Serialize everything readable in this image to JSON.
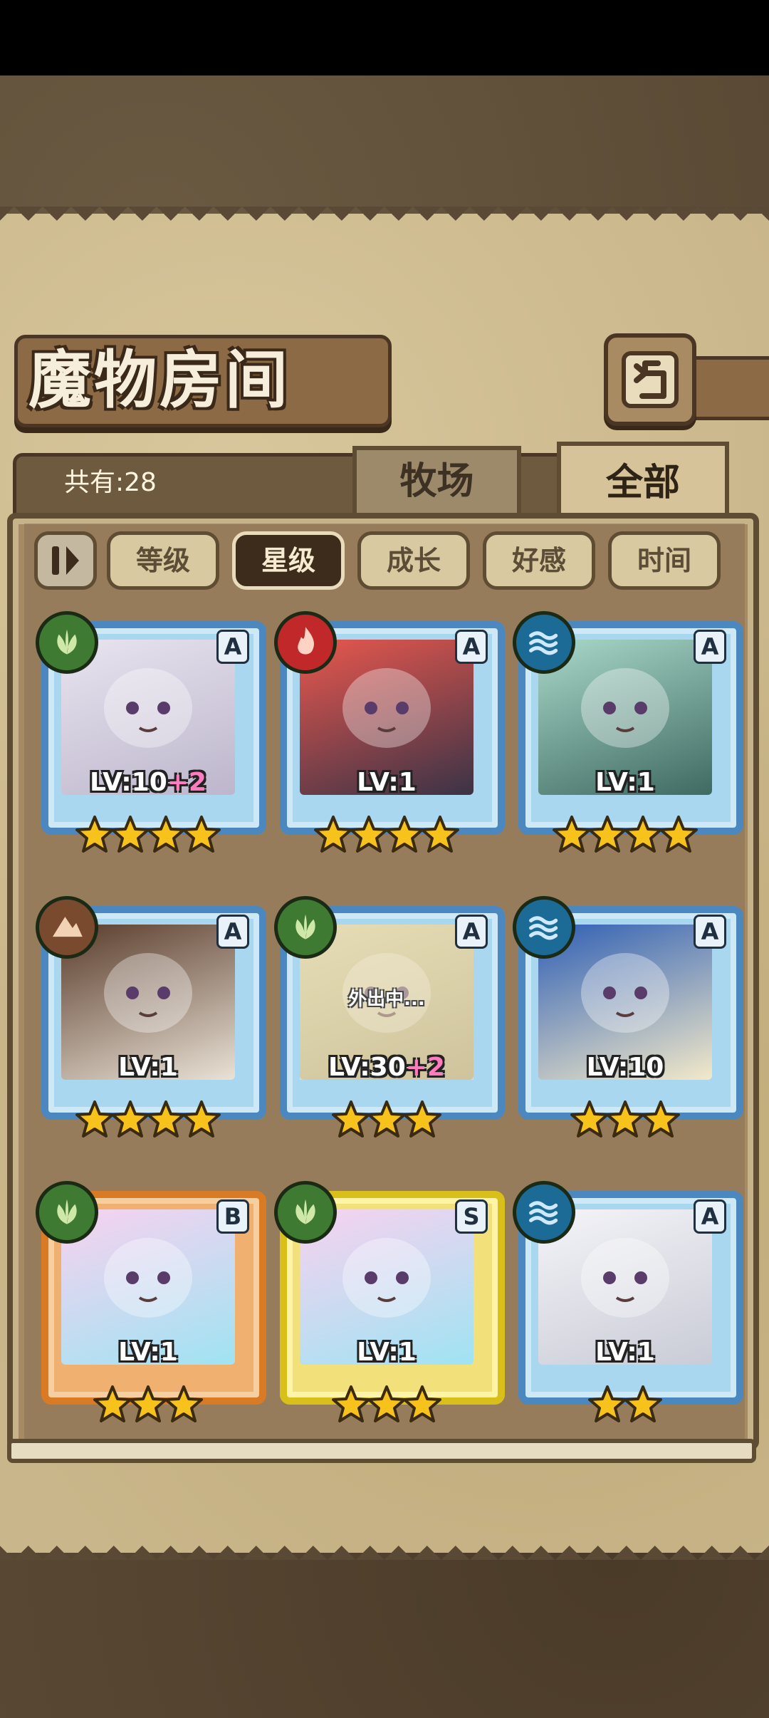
{
  "header": {
    "title": "魔物房间",
    "count_label": "共有:28",
    "tabs": [
      {
        "label": "牧场",
        "active": false
      },
      {
        "label": "全部",
        "active": true
      }
    ]
  },
  "sort": {
    "buttons": [
      {
        "label": "等级",
        "active": false
      },
      {
        "label": "星级",
        "active": true
      },
      {
        "label": "成长",
        "active": false
      },
      {
        "label": "好感",
        "active": false
      },
      {
        "label": "时间",
        "active": false
      }
    ]
  },
  "monsters": [
    {
      "element": "nature",
      "rank": "A",
      "level": "LV:10",
      "bonus": "+2",
      "stars": 4,
      "frame": "blue",
      "away": false
    },
    {
      "element": "fire",
      "rank": "A",
      "level": "LV:1",
      "bonus": "",
      "stars": 4,
      "frame": "blue",
      "away": false
    },
    {
      "element": "water",
      "rank": "A",
      "level": "LV:1",
      "bonus": "",
      "stars": 4,
      "frame": "blue",
      "away": false
    },
    {
      "element": "earth",
      "rank": "A",
      "level": "LV:1",
      "bonus": "",
      "stars": 4,
      "frame": "blue",
      "away": false
    },
    {
      "element": "nature",
      "rank": "A",
      "level": "LV:30",
      "bonus": "+2",
      "stars": 3,
      "frame": "blue",
      "away": true,
      "away_text": "外出中..."
    },
    {
      "element": "water",
      "rank": "A",
      "level": "LV:10",
      "bonus": "",
      "stars": 3,
      "frame": "blue",
      "away": false
    },
    {
      "element": "nature",
      "rank": "B",
      "level": "LV:1",
      "bonus": "",
      "stars": 3,
      "frame": "orange",
      "away": false
    },
    {
      "element": "nature",
      "rank": "S",
      "level": "LV:1",
      "bonus": "",
      "stars": 3,
      "frame": "yellow",
      "away": false
    },
    {
      "element": "water",
      "rank": "A",
      "level": "LV:1",
      "bonus": "",
      "stars": 2,
      "frame": "blue",
      "away": false
    }
  ],
  "colors": {
    "nature": "#3f7a32",
    "fire": "#c0282a",
    "water": "#1c6a96",
    "earth": "#7a4a2e",
    "star": "#f7c21c"
  }
}
